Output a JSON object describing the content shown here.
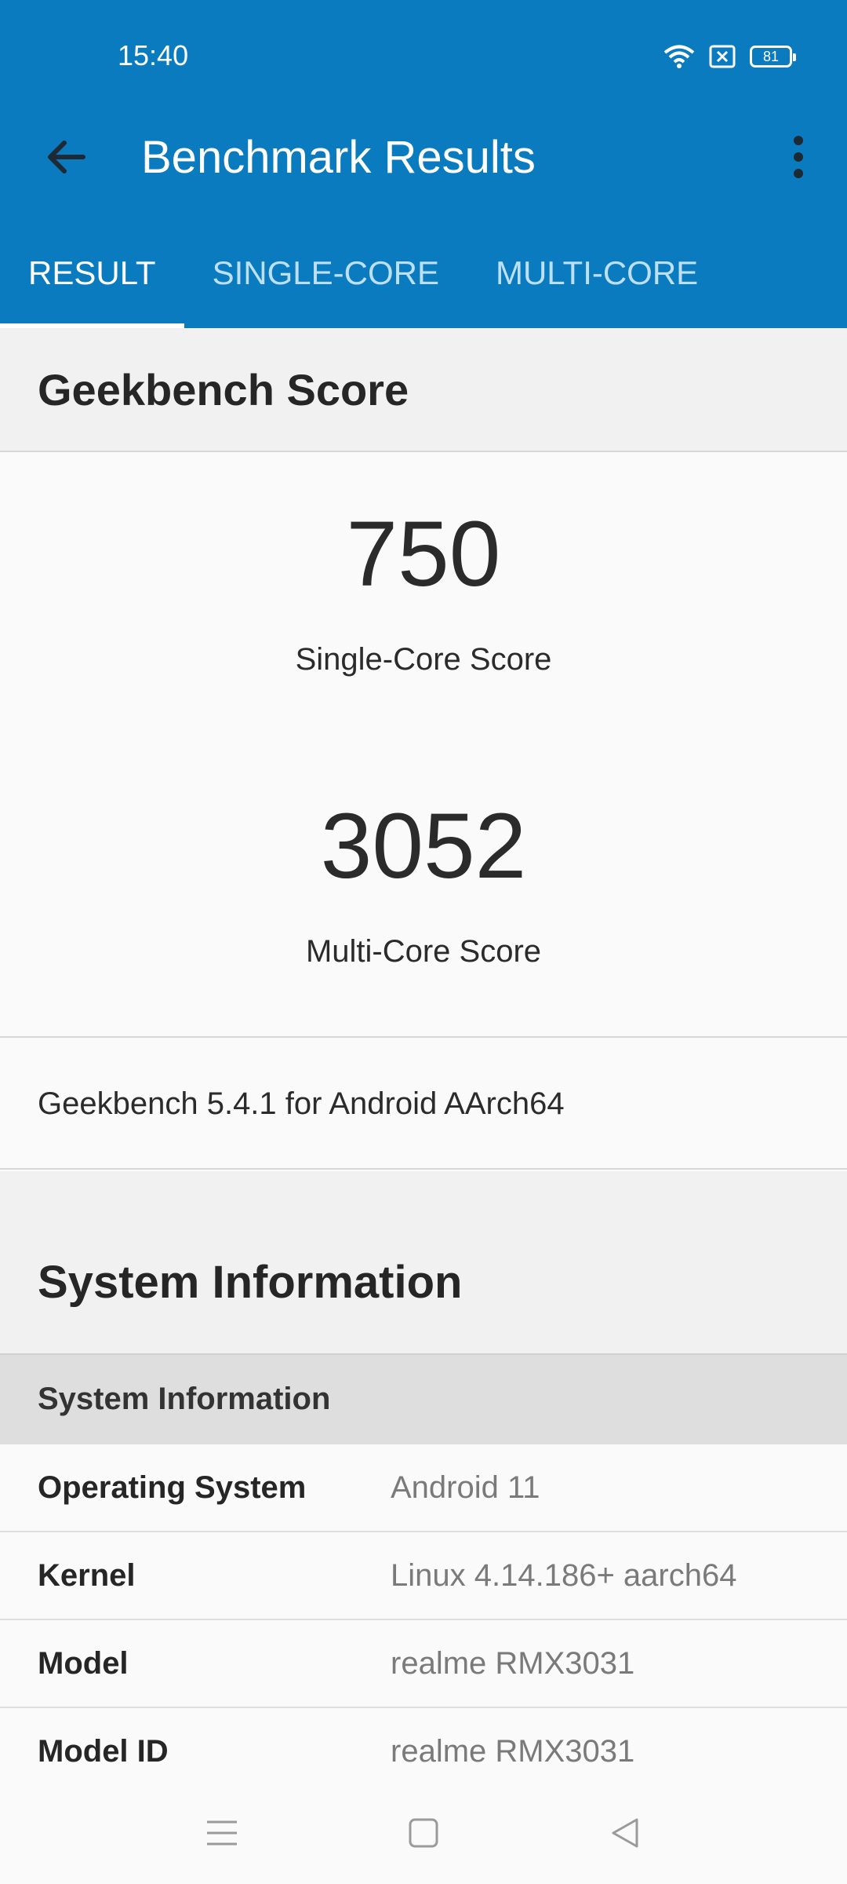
{
  "status": {
    "time": "15:40",
    "battery": "81"
  },
  "toolbar": {
    "title": "Benchmark Results"
  },
  "tabs": [
    {
      "label": "RESULT",
      "active": true
    },
    {
      "label": "SINGLE-CORE",
      "active": false
    },
    {
      "label": "MULTI-CORE",
      "active": false
    }
  ],
  "score_section": {
    "title": "Geekbench Score",
    "single_value": "750",
    "single_label": "Single-Core Score",
    "multi_value": "3052",
    "multi_label": "Multi-Core Score",
    "version": "Geekbench 5.4.1 for Android AArch64"
  },
  "system_section": {
    "title": "System Information",
    "subheader": "System Information",
    "rows": [
      {
        "key": "Operating System",
        "value": "Android 11"
      },
      {
        "key": "Kernel",
        "value": "Linux 4.14.186+ aarch64"
      },
      {
        "key": "Model",
        "value": "realme RMX3031"
      },
      {
        "key": "Model ID",
        "value": "realme RMX3031"
      }
    ]
  },
  "colors": {
    "appbar": "#0a7bbf",
    "tab_inactive": "#bde0f6"
  },
  "icons": {
    "back": "arrow-left-icon",
    "more": "more-vert-icon",
    "wifi": "wifi-icon",
    "sim": "sim-x-icon",
    "battery": "battery-icon",
    "nav_menu": "menu-icon",
    "nav_home": "home-square-icon",
    "nav_back": "back-triangle-icon"
  }
}
